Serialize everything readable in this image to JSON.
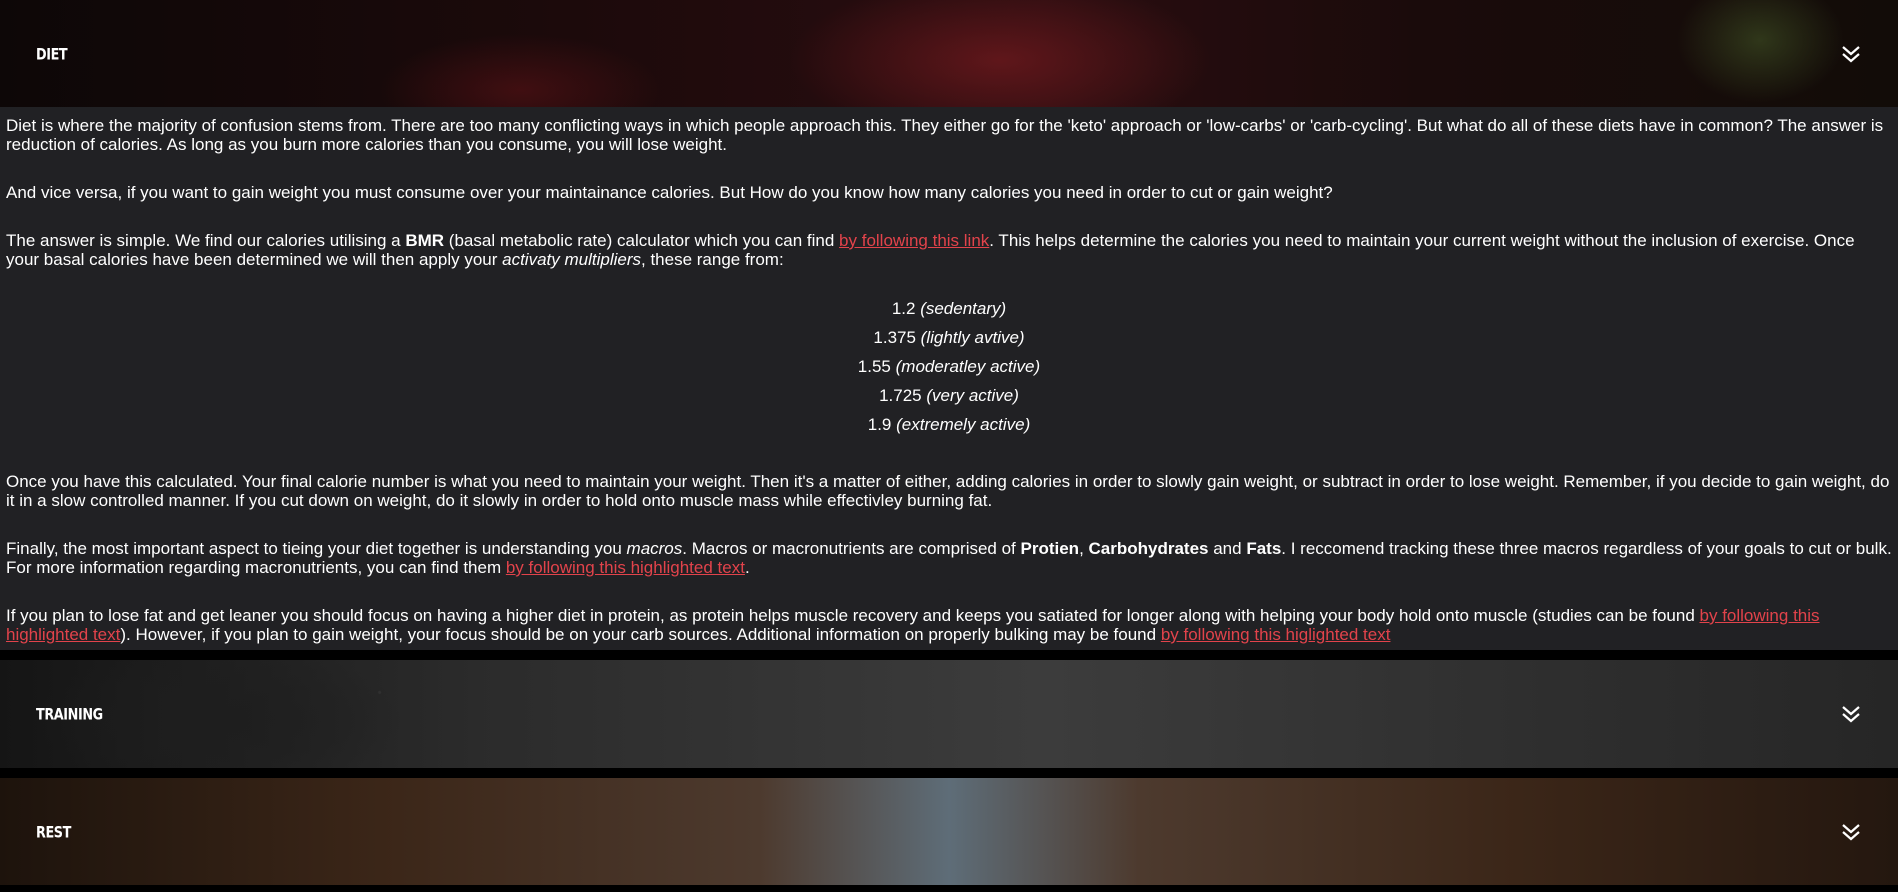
{
  "sections": {
    "diet": {
      "title": "DIET"
    },
    "training": {
      "title": "TRAINING"
    },
    "rest": {
      "title": "REST"
    }
  },
  "icons": {
    "expand": "double-chevron-down-icon"
  },
  "colors": {
    "link": "#e2434b",
    "content_bg": "#212124"
  },
  "content": {
    "p1": "Diet is where the majority of confusion stems from. There are too many conflicting ways in which people approach this. They either go for the 'keto' approach or 'low-carbs' or 'carb-cycling'. But what do all of these diets have in common? The answer is reduction of calories. As long as you burn more calories than you consume, you will lose weight.",
    "p2": "And vice versa, if you want to gain weight you must consume over your maintainance calories. But How do you know how many calories you need in order to cut or gain weight?",
    "p3": {
      "a": "The answer is simple. We find our calories utilising a ",
      "b": "BMR",
      "c": " (basal metabolic rate) calculator which you can find ",
      "link": "by following this link",
      "d": ". This helps determine the calories you need to maintain your current weight without the inclusion of exercise. Once your basal calories have been determined we will then apply your ",
      "e": "activaty multipliers",
      "f": ", these range from:"
    },
    "multipliers": [
      {
        "value": "1.2",
        "label": "(sedentary)"
      },
      {
        "value": "1.375",
        "label": "(lightly avtive)"
      },
      {
        "value": "1.55",
        "label": "(moderatley active)"
      },
      {
        "value": "1.725",
        "label": "(very active)"
      },
      {
        "value": "1.9",
        "label": "(extremely active)"
      }
    ],
    "p4": "Once you have this calculated. Your final calorie number is what you need to maintain your weight. Then it's a matter of either, adding calories in order to slowly gain weight, or subtract in order to lose weight. Remember, if you decide to gain weight, do it in a slow controlled manner. If you cut down on weight, do it slowly in order to hold onto muscle mass while effectivley burning fat.",
    "p5": {
      "a": "Finally, the most important aspect to tieing your diet together is understanding you ",
      "b": "macros",
      "c": ". Macros or macronutrients are comprised of ",
      "d": "Protien",
      "e": ", ",
      "f": "Carbohydrates",
      "g": " and ",
      "h": "Fats",
      "i": ". I reccomend tracking these three macros regardless of your goals to cut or bulk. For more information regarding macronutrients, you can find them ",
      "link": "by following this highlighted text",
      "j": "."
    },
    "p6": {
      "a": "If you plan to lose fat and get leaner you should focus on having a higher diet in protein, as protein helps muscle recovery and keeps you satiated for longer along with helping your body hold onto muscle (studies can be found ",
      "link1": "by following this highlighted text",
      "b": "). However, if you plan to gain weight, your focus should be on your carb sources. Additional information on properly bulking may be found ",
      "link2": "by following this higlighted text"
    }
  }
}
